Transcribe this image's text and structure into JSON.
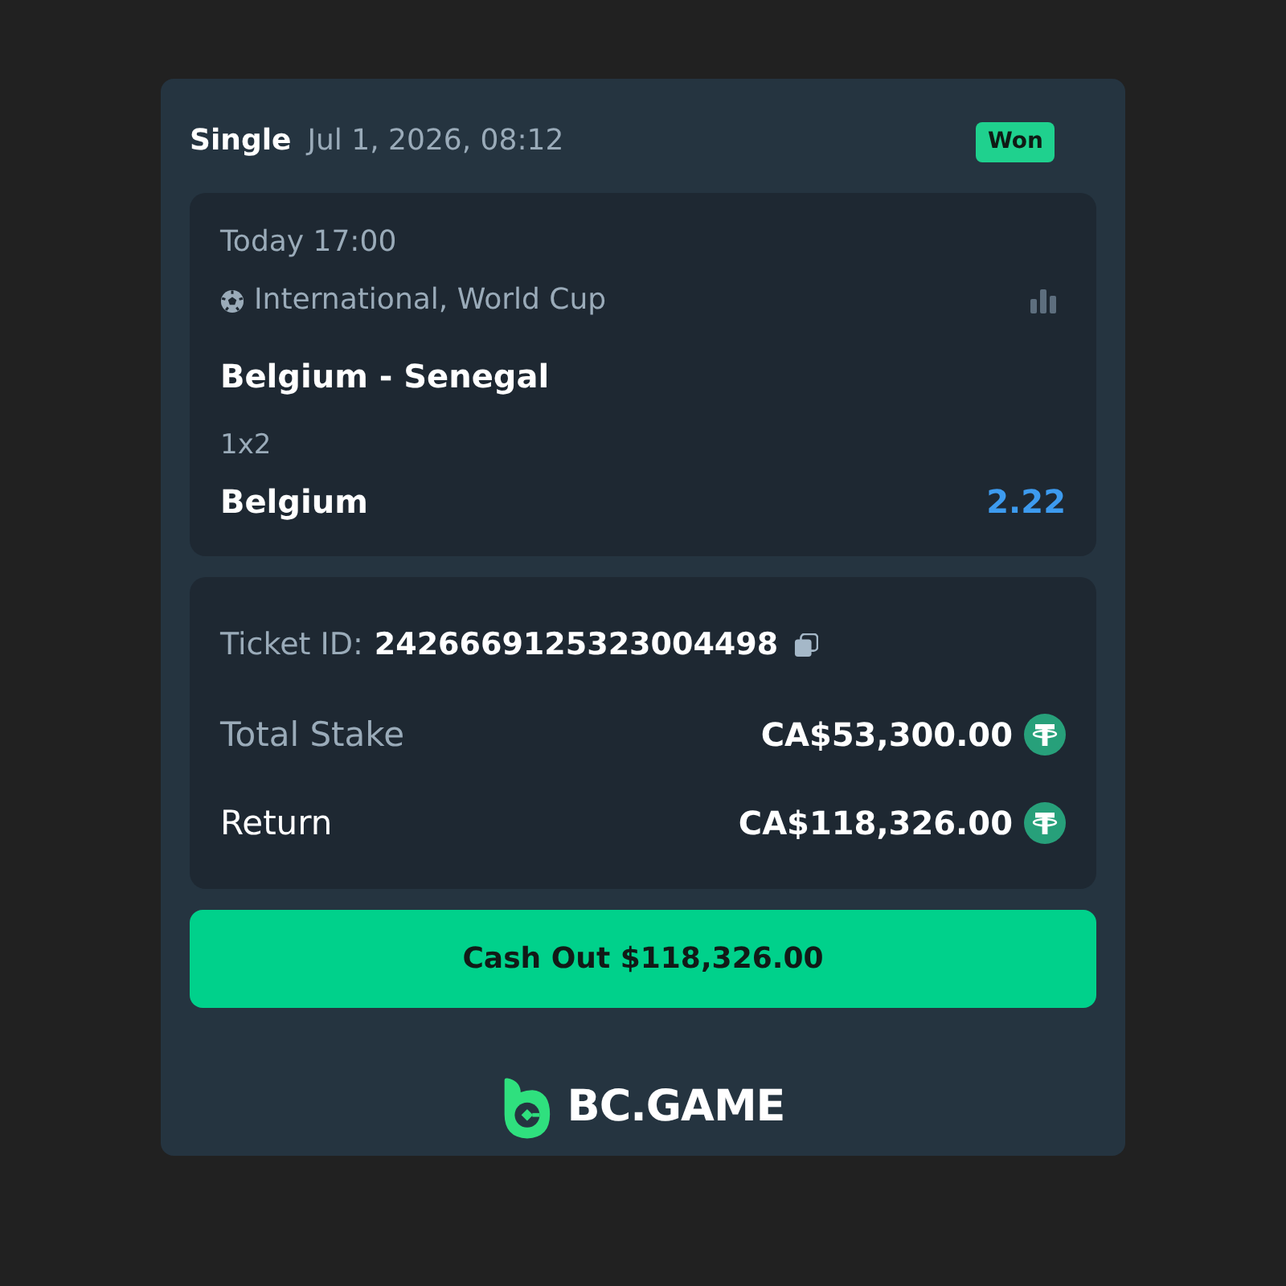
{
  "bet": {
    "type": "Single",
    "placed": "Jul 1, 2026, 08:12",
    "status": "Won"
  },
  "event": {
    "time": "Today 17:00",
    "league": "International, World Cup",
    "match": "Belgium - Senegal",
    "market": "1x2",
    "selection": "Belgium",
    "odds": "2.22"
  },
  "ticket": {
    "label": "Ticket ID:",
    "id": "2426669125323004498"
  },
  "amounts": [
    {
      "label": "Total Stake",
      "value": "CA$53,300.00",
      "kind": "stake"
    },
    {
      "label": "Return",
      "value": "CA$118,326.00",
      "kind": "return"
    }
  ],
  "cash_out": {
    "label": "Cash Out $118,326.00"
  },
  "brand": {
    "name": "BC.GAME"
  }
}
